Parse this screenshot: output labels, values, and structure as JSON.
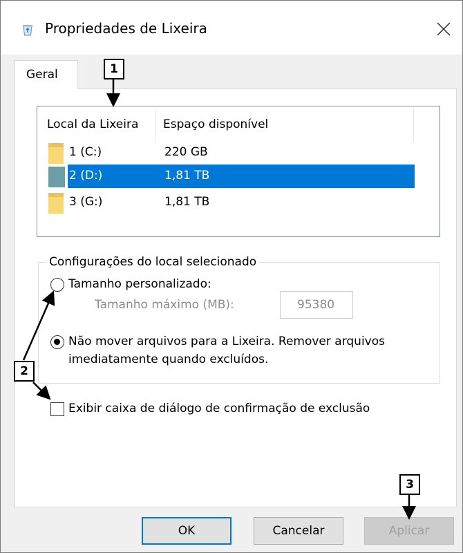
{
  "window": {
    "title": "Propriedades de Lixeira",
    "close_label": "✕"
  },
  "tabs": [
    {
      "label": "Geral",
      "active": true
    }
  ],
  "listview": {
    "columns": [
      "Local da Lixeira",
      "Espaço disponível"
    ],
    "rows": [
      {
        "location": "1 (C:)",
        "space": "220 GB",
        "selected": false
      },
      {
        "location": "2 (D:)",
        "space": "1,81 TB",
        "selected": true
      },
      {
        "location": "3 (G:)",
        "space": "1,81 TB",
        "selected": false
      }
    ]
  },
  "settings": {
    "group_title": "Configurações do local selecionado",
    "custom_size_label": "Tamanho personalizado:",
    "custom_size_checked": false,
    "max_size_label": "Tamanho máximo (MB):",
    "max_size_value": "95380",
    "no_move_label_line1": "Não mover arquivos para a Lixeira. Remover arquivos",
    "no_move_label_line2": "imediatamente quando excluídos.",
    "no_move_checked": true
  },
  "confirm": {
    "label": "Exibir caixa de diálogo de confirmação de exclusão",
    "checked": false
  },
  "buttons": {
    "ok": "OK",
    "cancel": "Cancelar",
    "apply": "Aplicar"
  },
  "callouts": [
    "1",
    "2",
    "3"
  ],
  "colors": {
    "selection": "#0078d7",
    "folder": "#f8d775",
    "folder_selected": "#6b9ea6"
  }
}
